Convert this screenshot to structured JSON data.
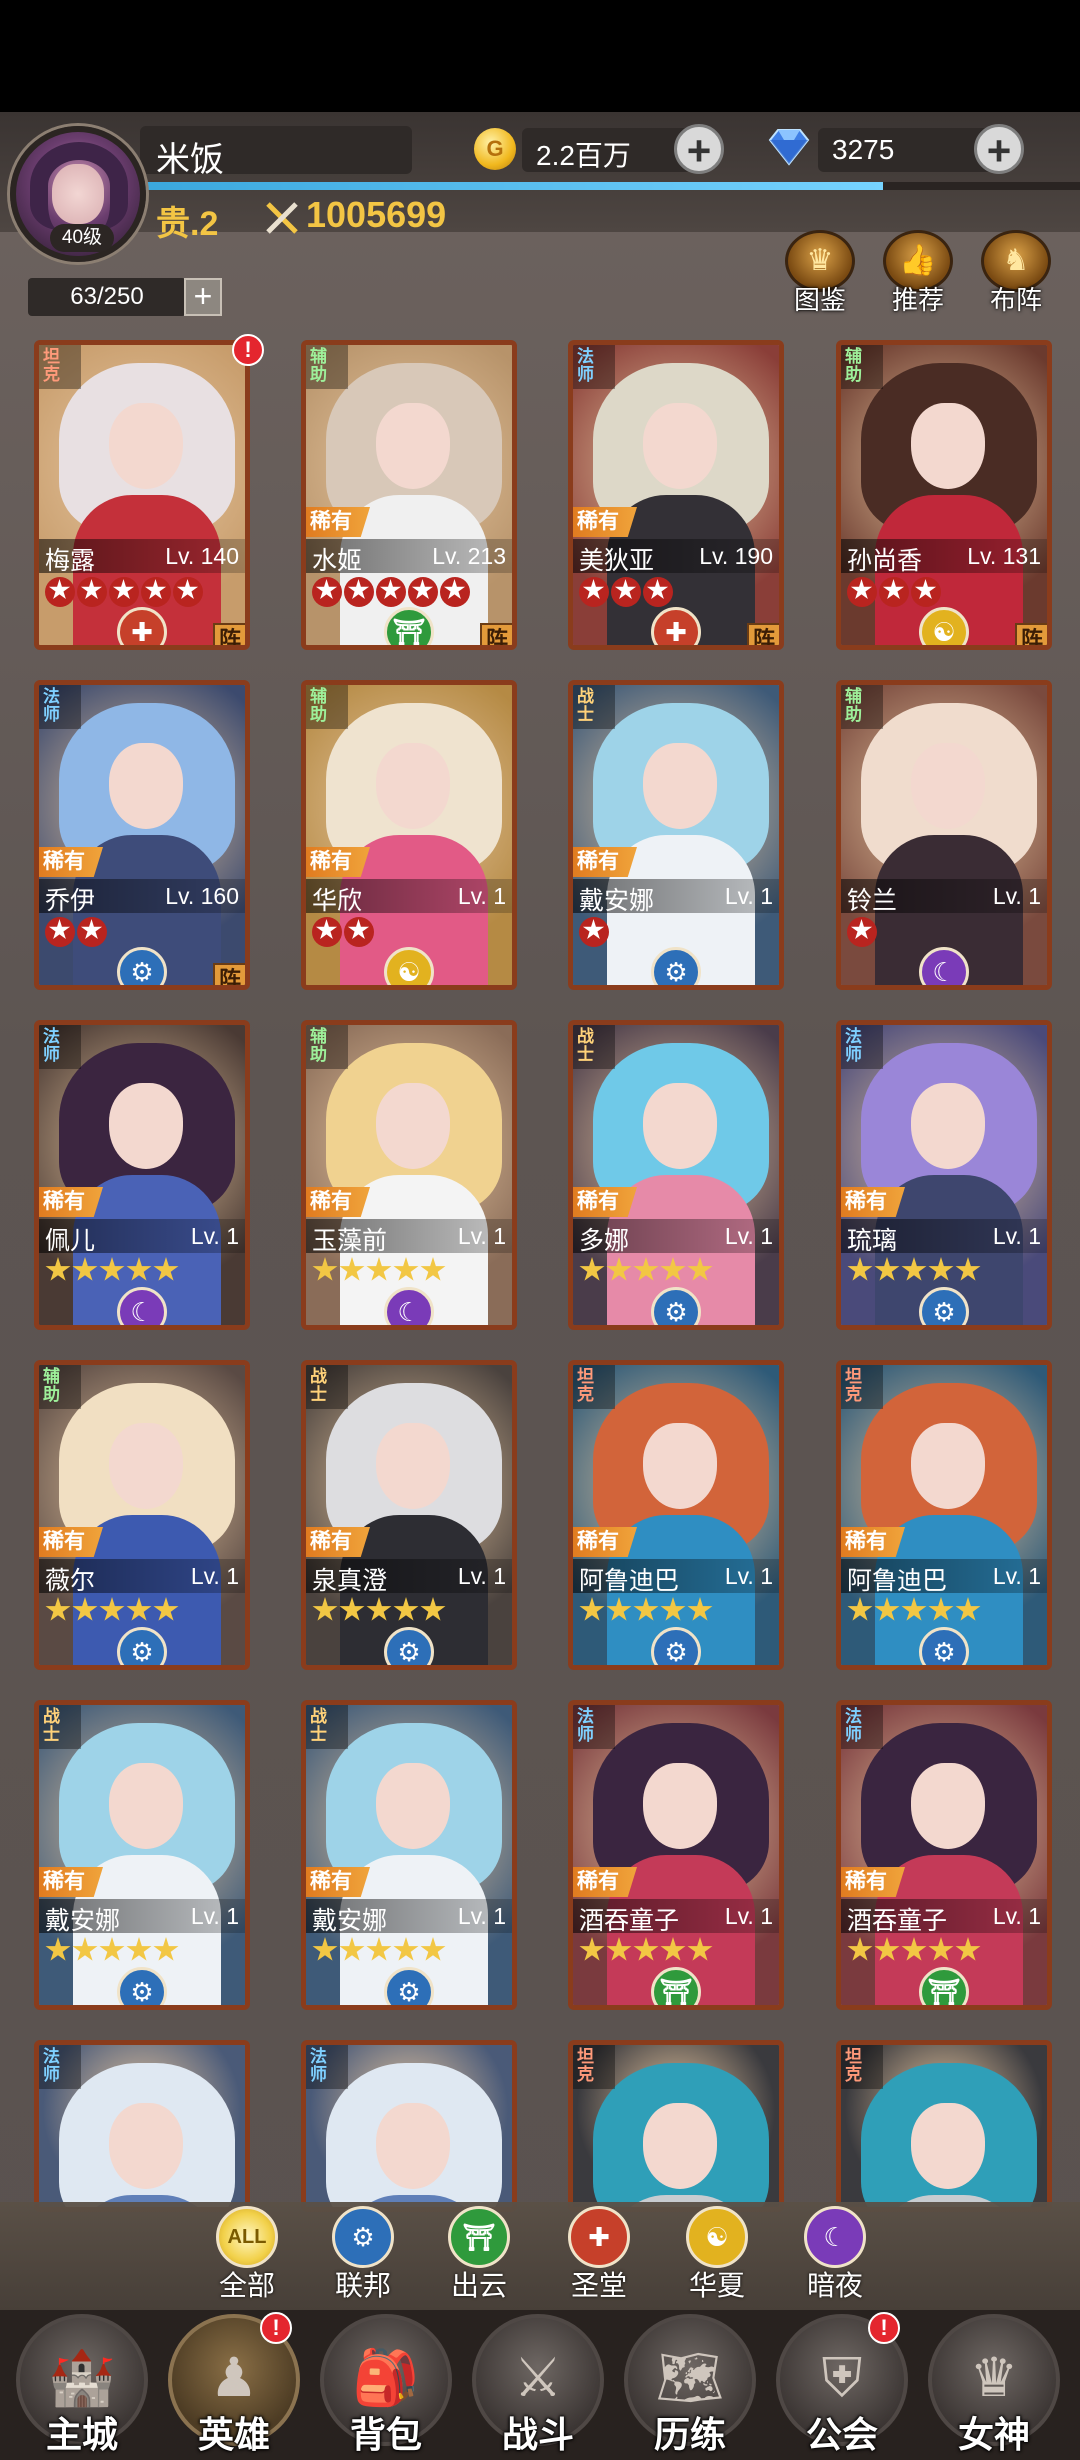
{
  "player": {
    "name": "米饭",
    "level": "40级",
    "vip": "贵.2",
    "power": "1005699",
    "exp_fraction": 0.79
  },
  "currency": {
    "gold": "2.2百万",
    "gold_icon": "G",
    "gems": "3275"
  },
  "hero_count": "63/250",
  "quick_buttons": [
    {
      "label": "图鉴",
      "icon": "crown-icon"
    },
    {
      "label": "推荐",
      "icon": "thumbs-up-icon"
    },
    {
      "label": "布阵",
      "icon": "chess-knight-icon"
    }
  ],
  "rarity_label": "稀有",
  "lineup_tag": "阵",
  "heroes": [
    {
      "name": "梅露",
      "role": "坦克",
      "level": "Lv. 140",
      "stars": 5,
      "red_stars": true,
      "faction": "圣堂",
      "rare": false,
      "lineup": true,
      "alert": true
    },
    {
      "name": "水姬",
      "role": "辅助",
      "level": "Lv. 213",
      "stars": 5,
      "red_stars": true,
      "faction": "出云",
      "rare": true,
      "lineup": true,
      "alert": false
    },
    {
      "name": "美狄亚",
      "role": "法师",
      "level": "Lv. 190",
      "stars": 3,
      "red_stars": true,
      "faction": "圣堂",
      "rare": true,
      "lineup": true,
      "alert": false
    },
    {
      "name": "孙尚香",
      "role": "辅助",
      "level": "Lv. 131",
      "stars": 3,
      "red_stars": true,
      "faction": "华夏",
      "rare": false,
      "lineup": true,
      "alert": false
    },
    {
      "name": "乔伊",
      "role": "法师",
      "level": "Lv. 160",
      "stars": 2,
      "red_stars": true,
      "faction": "联邦",
      "rare": true,
      "lineup": true,
      "alert": false
    },
    {
      "name": "华欣",
      "role": "辅助",
      "level": "Lv. 1",
      "stars": 2,
      "red_stars": true,
      "faction": "华夏",
      "rare": true,
      "lineup": false,
      "alert": false
    },
    {
      "name": "戴安娜",
      "role": "战士",
      "level": "Lv. 1",
      "stars": 1,
      "red_stars": true,
      "faction": "联邦",
      "rare": true,
      "lineup": false,
      "alert": false
    },
    {
      "name": "铃兰",
      "role": "辅助",
      "level": "Lv. 1",
      "stars": 1,
      "red_stars": true,
      "faction": "暗夜",
      "rare": false,
      "lineup": false,
      "alert": false
    },
    {
      "name": "佩儿",
      "role": "法师",
      "level": "Lv. 1",
      "stars": 5,
      "red_stars": false,
      "faction": "暗夜",
      "rare": true,
      "lineup": false,
      "alert": false
    },
    {
      "name": "玉藻前",
      "role": "辅助",
      "level": "Lv. 1",
      "stars": 5,
      "red_stars": false,
      "faction": "暗夜",
      "rare": true,
      "lineup": false,
      "alert": false
    },
    {
      "name": "多娜",
      "role": "战士",
      "level": "Lv. 1",
      "stars": 5,
      "red_stars": false,
      "faction": "联邦",
      "rare": true,
      "lineup": false,
      "alert": false
    },
    {
      "name": "琉璃",
      "role": "法师",
      "level": "Lv. 1",
      "stars": 5,
      "red_stars": false,
      "faction": "联邦",
      "rare": true,
      "lineup": false,
      "alert": false
    },
    {
      "name": "薇尔",
      "role": "辅助",
      "level": "Lv. 1",
      "stars": 5,
      "red_stars": false,
      "faction": "联邦",
      "rare": true,
      "lineup": false,
      "alert": false
    },
    {
      "name": "泉真澄",
      "role": "战士",
      "level": "Lv. 1",
      "stars": 5,
      "red_stars": false,
      "faction": "联邦",
      "rare": true,
      "lineup": false,
      "alert": false
    },
    {
      "name": "阿鲁迪巴",
      "role": "坦克",
      "level": "Lv. 1",
      "stars": 5,
      "red_stars": false,
      "faction": "联邦",
      "rare": true,
      "lineup": false,
      "alert": false
    },
    {
      "name": "阿鲁迪巴",
      "role": "坦克",
      "level": "Lv. 1",
      "stars": 5,
      "red_stars": false,
      "faction": "联邦",
      "rare": true,
      "lineup": false,
      "alert": false
    },
    {
      "name": "戴安娜",
      "role": "战士",
      "level": "Lv. 1",
      "stars": 5,
      "red_stars": false,
      "faction": "联邦",
      "rare": true,
      "lineup": false,
      "alert": false
    },
    {
      "name": "戴安娜",
      "role": "战士",
      "level": "Lv. 1",
      "stars": 5,
      "red_stars": false,
      "faction": "联邦",
      "rare": true,
      "lineup": false,
      "alert": false
    },
    {
      "name": "酒吞童子",
      "role": "法师",
      "level": "Lv. 1",
      "stars": 5,
      "red_stars": false,
      "faction": "出云",
      "rare": true,
      "lineup": false,
      "alert": false
    },
    {
      "name": "酒吞童子",
      "role": "法师",
      "level": "Lv. 1",
      "stars": 5,
      "red_stars": false,
      "faction": "出云",
      "rare": true,
      "lineup": false,
      "alert": false
    },
    {
      "name": "",
      "role": "法师",
      "level": "",
      "stars": 0,
      "red_stars": false,
      "faction": "",
      "rare": false,
      "lineup": false,
      "alert": false
    },
    {
      "name": "",
      "role": "法师",
      "level": "",
      "stars": 0,
      "red_stars": false,
      "faction": "",
      "rare": false,
      "lineup": false,
      "alert": false
    },
    {
      "name": "",
      "role": "坦克",
      "level": "",
      "stars": 0,
      "red_stars": false,
      "faction": "",
      "rare": false,
      "lineup": false,
      "alert": false
    },
    {
      "name": "",
      "role": "坦克",
      "level": "",
      "stars": 0,
      "red_stars": false,
      "faction": "",
      "rare": false,
      "lineup": false,
      "alert": false
    }
  ],
  "faction_filters": [
    {
      "label": "全部",
      "icon_text": "ALL",
      "icon": "all-icon",
      "color": "#f2d14a",
      "active": true
    },
    {
      "label": "联邦",
      "icon_text": "⚙",
      "icon": "gear-icon",
      "color": "#2d6fb8",
      "active": false
    },
    {
      "label": "出云",
      "icon_text": "⛩",
      "icon": "torii-icon",
      "color": "#2f9a3c",
      "active": false
    },
    {
      "label": "圣堂",
      "icon_text": "✚",
      "icon": "holy-cross-icon",
      "color": "#c6402a",
      "active": false
    },
    {
      "label": "华夏",
      "icon_text": "☯",
      "icon": "cloud-swirl-icon",
      "color": "#e2b21f",
      "active": false
    },
    {
      "label": "暗夜",
      "icon_text": "☾",
      "icon": "moon-icon",
      "color": "#7a3bb8",
      "active": false
    }
  ],
  "faction_colors": {
    "联邦": "#2d6fb8",
    "出云": "#2f9a3c",
    "圣堂": "#c6402a",
    "华夏": "#e2b21f",
    "暗夜": "#7a3bb8"
  },
  "faction_glyphs": {
    "联邦": "⚙",
    "出云": "⛩",
    "圣堂": "✚",
    "华夏": "☯",
    "暗夜": "☾"
  },
  "bottom_nav": [
    {
      "label": "主城",
      "icon": "castle-icon",
      "glyph": "🏰",
      "active": false,
      "alert": false
    },
    {
      "label": "英雄",
      "icon": "hero-hood-icon",
      "glyph": "♟",
      "active": true,
      "alert": true
    },
    {
      "label": "背包",
      "icon": "backpack-icon",
      "glyph": "🎒",
      "active": false,
      "alert": false
    },
    {
      "label": "战斗",
      "icon": "crossed-swords-icon",
      "glyph": "⚔",
      "active": false,
      "alert": false
    },
    {
      "label": "历练",
      "icon": "map-icon",
      "glyph": "🗺",
      "active": false,
      "alert": false
    },
    {
      "label": "公会",
      "icon": "guild-shield-icon",
      "glyph": "⛨",
      "active": false,
      "alert": true
    },
    {
      "label": "女神",
      "icon": "goddess-icon",
      "glyph": "♛",
      "active": false,
      "alert": false
    }
  ],
  "alert_mark": "!"
}
